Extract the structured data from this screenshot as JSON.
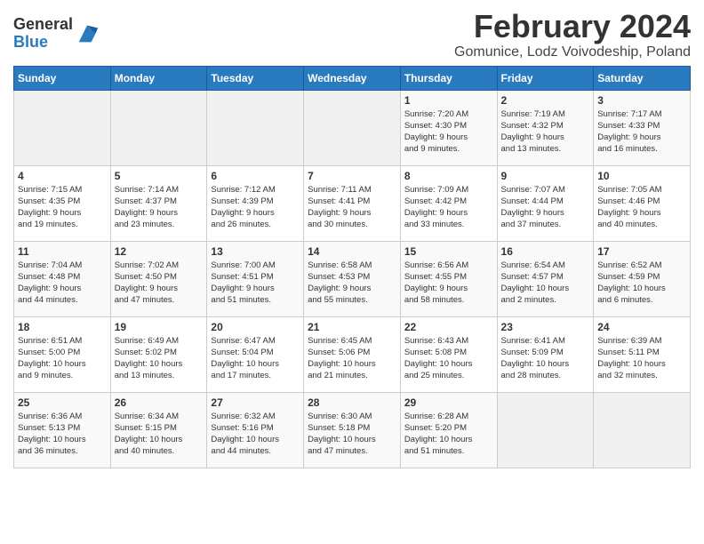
{
  "logo": {
    "general": "General",
    "blue": "Blue"
  },
  "title": {
    "month": "February 2024",
    "location": "Gomunice, Lodz Voivodeship, Poland"
  },
  "weekdays": [
    "Sunday",
    "Monday",
    "Tuesday",
    "Wednesday",
    "Thursday",
    "Friday",
    "Saturday"
  ],
  "weeks": [
    [
      {
        "day": "",
        "info": ""
      },
      {
        "day": "",
        "info": ""
      },
      {
        "day": "",
        "info": ""
      },
      {
        "day": "",
        "info": ""
      },
      {
        "day": "1",
        "info": "Sunrise: 7:20 AM\nSunset: 4:30 PM\nDaylight: 9 hours\nand 9 minutes."
      },
      {
        "day": "2",
        "info": "Sunrise: 7:19 AM\nSunset: 4:32 PM\nDaylight: 9 hours\nand 13 minutes."
      },
      {
        "day": "3",
        "info": "Sunrise: 7:17 AM\nSunset: 4:33 PM\nDaylight: 9 hours\nand 16 minutes."
      }
    ],
    [
      {
        "day": "4",
        "info": "Sunrise: 7:15 AM\nSunset: 4:35 PM\nDaylight: 9 hours\nand 19 minutes."
      },
      {
        "day": "5",
        "info": "Sunrise: 7:14 AM\nSunset: 4:37 PM\nDaylight: 9 hours\nand 23 minutes."
      },
      {
        "day": "6",
        "info": "Sunrise: 7:12 AM\nSunset: 4:39 PM\nDaylight: 9 hours\nand 26 minutes."
      },
      {
        "day": "7",
        "info": "Sunrise: 7:11 AM\nSunset: 4:41 PM\nDaylight: 9 hours\nand 30 minutes."
      },
      {
        "day": "8",
        "info": "Sunrise: 7:09 AM\nSunset: 4:42 PM\nDaylight: 9 hours\nand 33 minutes."
      },
      {
        "day": "9",
        "info": "Sunrise: 7:07 AM\nSunset: 4:44 PM\nDaylight: 9 hours\nand 37 minutes."
      },
      {
        "day": "10",
        "info": "Sunrise: 7:05 AM\nSunset: 4:46 PM\nDaylight: 9 hours\nand 40 minutes."
      }
    ],
    [
      {
        "day": "11",
        "info": "Sunrise: 7:04 AM\nSunset: 4:48 PM\nDaylight: 9 hours\nand 44 minutes."
      },
      {
        "day": "12",
        "info": "Sunrise: 7:02 AM\nSunset: 4:50 PM\nDaylight: 9 hours\nand 47 minutes."
      },
      {
        "day": "13",
        "info": "Sunrise: 7:00 AM\nSunset: 4:51 PM\nDaylight: 9 hours\nand 51 minutes."
      },
      {
        "day": "14",
        "info": "Sunrise: 6:58 AM\nSunset: 4:53 PM\nDaylight: 9 hours\nand 55 minutes."
      },
      {
        "day": "15",
        "info": "Sunrise: 6:56 AM\nSunset: 4:55 PM\nDaylight: 9 hours\nand 58 minutes."
      },
      {
        "day": "16",
        "info": "Sunrise: 6:54 AM\nSunset: 4:57 PM\nDaylight: 10 hours\nand 2 minutes."
      },
      {
        "day": "17",
        "info": "Sunrise: 6:52 AM\nSunset: 4:59 PM\nDaylight: 10 hours\nand 6 minutes."
      }
    ],
    [
      {
        "day": "18",
        "info": "Sunrise: 6:51 AM\nSunset: 5:00 PM\nDaylight: 10 hours\nand 9 minutes."
      },
      {
        "day": "19",
        "info": "Sunrise: 6:49 AM\nSunset: 5:02 PM\nDaylight: 10 hours\nand 13 minutes."
      },
      {
        "day": "20",
        "info": "Sunrise: 6:47 AM\nSunset: 5:04 PM\nDaylight: 10 hours\nand 17 minutes."
      },
      {
        "day": "21",
        "info": "Sunrise: 6:45 AM\nSunset: 5:06 PM\nDaylight: 10 hours\nand 21 minutes."
      },
      {
        "day": "22",
        "info": "Sunrise: 6:43 AM\nSunset: 5:08 PM\nDaylight: 10 hours\nand 25 minutes."
      },
      {
        "day": "23",
        "info": "Sunrise: 6:41 AM\nSunset: 5:09 PM\nDaylight: 10 hours\nand 28 minutes."
      },
      {
        "day": "24",
        "info": "Sunrise: 6:39 AM\nSunset: 5:11 PM\nDaylight: 10 hours\nand 32 minutes."
      }
    ],
    [
      {
        "day": "25",
        "info": "Sunrise: 6:36 AM\nSunset: 5:13 PM\nDaylight: 10 hours\nand 36 minutes."
      },
      {
        "day": "26",
        "info": "Sunrise: 6:34 AM\nSunset: 5:15 PM\nDaylight: 10 hours\nand 40 minutes."
      },
      {
        "day": "27",
        "info": "Sunrise: 6:32 AM\nSunset: 5:16 PM\nDaylight: 10 hours\nand 44 minutes."
      },
      {
        "day": "28",
        "info": "Sunrise: 6:30 AM\nSunset: 5:18 PM\nDaylight: 10 hours\nand 47 minutes."
      },
      {
        "day": "29",
        "info": "Sunrise: 6:28 AM\nSunset: 5:20 PM\nDaylight: 10 hours\nand 51 minutes."
      },
      {
        "day": "",
        "info": ""
      },
      {
        "day": "",
        "info": ""
      }
    ]
  ]
}
